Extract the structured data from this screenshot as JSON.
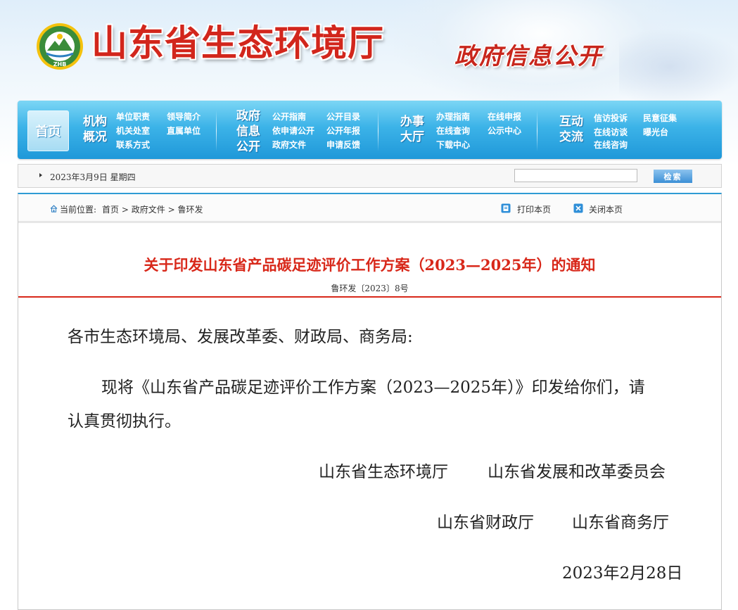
{
  "header": {
    "logo_text": "ZHB",
    "site_title": "山东省生态环境厅",
    "section_title": "政府信息公开"
  },
  "nav": {
    "home": "首页",
    "groups": [
      {
        "title_line1": "机构",
        "title_line2": "概况",
        "links": [
          "单位职责",
          "领导简介",
          "机关处室",
          "直属单位",
          "联系方式"
        ]
      },
      {
        "title_line1": "政府",
        "title_line2": "信息",
        "title_line3": "公开",
        "links": [
          "公开指南",
          "公开目录",
          "依申请公开",
          "公开年报",
          "政府文件",
          "申请反馈"
        ]
      },
      {
        "title_line1": "办事",
        "title_line2": "大厅",
        "links": [
          "办理指南",
          "在线申报",
          "在线查询",
          "公示中心",
          "下载中心"
        ]
      },
      {
        "title_line1": "互动",
        "title_line2": "交流",
        "links": [
          "信访投诉",
          "民意征集",
          "在线访谈",
          "曝光台",
          "在线咨询"
        ]
      }
    ]
  },
  "infobar": {
    "date": "2023年3月9日 星期四",
    "search_placeholder": "",
    "search_button": "检索"
  },
  "breadcrumb": {
    "label": "当前位置:",
    "items": [
      "首页",
      "政府文件",
      "鲁环发"
    ],
    "separator": ">",
    "print": "打印本页",
    "close": "关闭本页"
  },
  "document": {
    "title": "关于印发山东省产品碳足迹评价工作方案（2023—2025年）的通知",
    "number": "鲁环发〔2023〕8号",
    "salutation": "各市生态环境局、发展改革委、财政局、商务局:",
    "body_line1": "现将《山东省产品碳足迹评价工作方案（2023—2025年）》印发给你们，请",
    "body_line2": "认真贯彻执行。",
    "signers": [
      "山东省生态环境厅",
      "山东省发展和改革委员会",
      "山东省财政厅",
      "山东省商务厅"
    ],
    "date": "2023年2月28日"
  },
  "colors": {
    "title_red": "#d8281a",
    "nav_blue": "#2ea6e0",
    "logo_green": "#3a8c3a"
  }
}
